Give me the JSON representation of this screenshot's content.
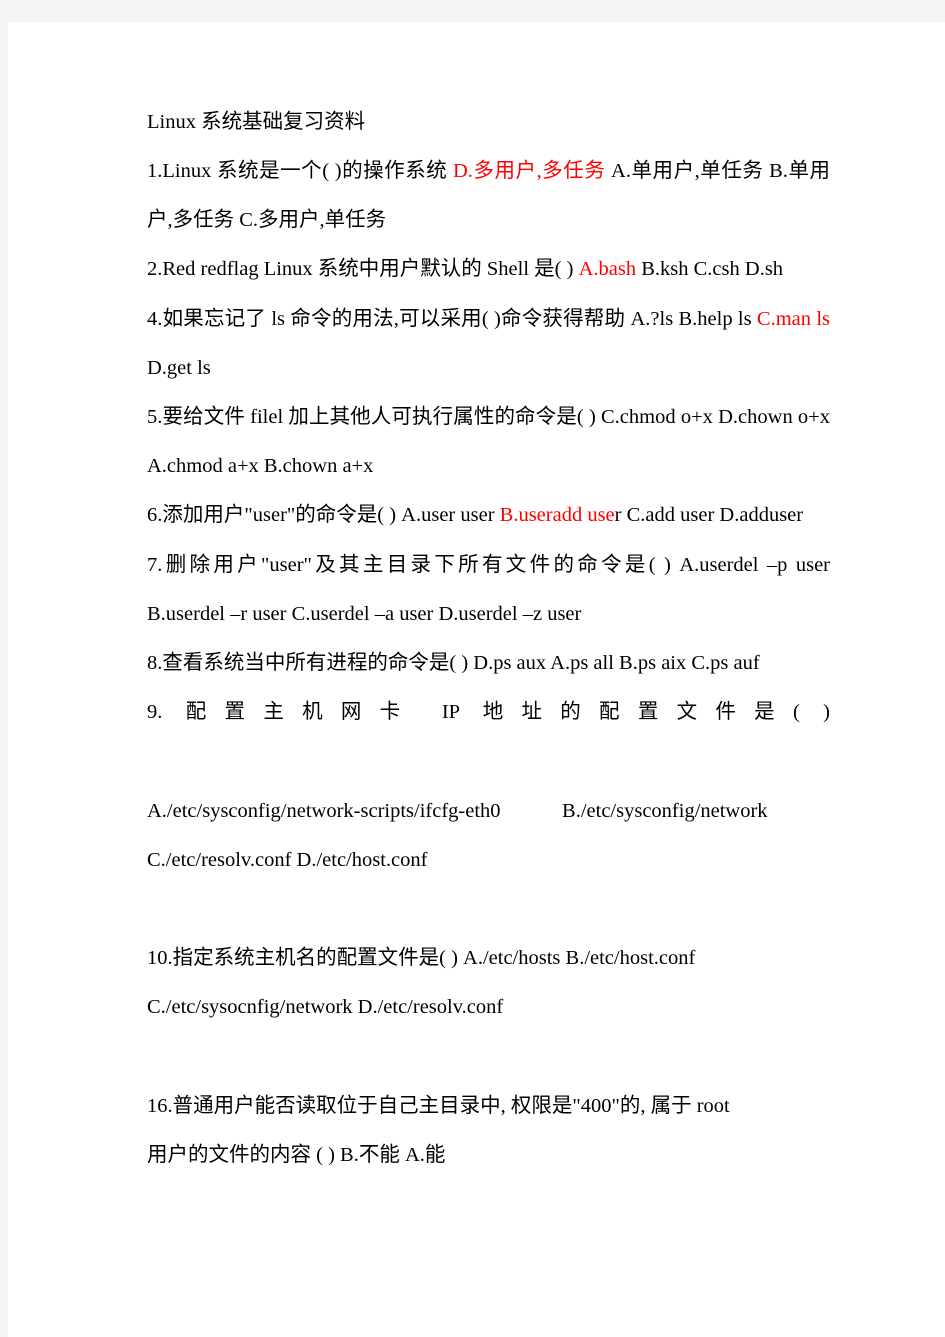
{
  "document": {
    "title": "Linux 系统基础复习资料",
    "background_color": "#f4f4f4",
    "page_color": "#ffffff",
    "text_color": "#000000",
    "highlight_color": "#ff0000"
  },
  "questions": [
    {
      "id": "q1",
      "stem": "1.Linux  系统是一个(  )的操作系统  ",
      "answer_highlight": "D.多用户,多任务",
      "options_tail": "  A.单用户,单任务  B.单用户,多任务  C.多用户,单任务"
    },
    {
      "id": "q2",
      "stem": "2.Red  redflag  Linux  系统中用户默认的  Shell  是(  )  ",
      "answer_highlight": "A.bash",
      "options_tail": "  B.ksh  C.csh  D.sh"
    },
    {
      "id": "q4",
      "stem": "4.如果忘记了  ls  命令的用法,可以采用(  )命令获得帮助  A.?ls  B.help  ls  ",
      "answer_highlight": "C.man  ls",
      "options_tail": "  D.get  ls"
    },
    {
      "id": "q5",
      "stem": "5.要给文件  filel   加上其他人可执行属性的命令是(  )  C.chmod  o+x  D.chown  o+x  A.chmod  a+x  B.chown  a+x",
      "answer_highlight": "",
      "options_tail": ""
    },
    {
      "id": "q6",
      "stem": "6.添加用户\"user\"的命令是(  )  A.user  user  ",
      "answer_highlight": "B.useradd  use",
      "options_tail": "r  C.add  user  D.adduser"
    },
    {
      "id": "q7",
      "stem": "7.删除用户\"user\"及其主目录下所有文件的命令是(  )  A.userdel  –p  user  B.userdel  –r  user  C.userdel  –a  user  D.userdel  –z  user",
      "answer_highlight": "",
      "options_tail": ""
    },
    {
      "id": "q8",
      "stem": "8.查看系统当中所有进程的命令是(  )  D.ps  aux  A.ps  all  B.ps  aix  C.ps  auf",
      "answer_highlight": "",
      "options_tail": ""
    }
  ],
  "question9": {
    "id": "q9",
    "stem_line": "9. 配置主机网卡  IP  地址的配置文件是(  )",
    "options_line1": "A./etc/sysconfig/network-scripts/ifcfg-eth0",
    "options_line1b": "B./etc/sysconfig/network",
    "options_line2": "C./etc/resolv.conf D./etc/host.conf"
  },
  "question10": {
    "id": "q10",
    "line1": "10.指定系统主机名的配置文件是(  )  A./etc/hosts   B./etc/host.conf",
    "line2": "C./etc/sysocnfig/network D./etc/resolv.conf"
  },
  "question16": {
    "id": "q16",
    "line1": "16.普通用户能否读取位于自己主目录中, 权限是\"400\"的, 属于  root",
    "line2": "用户的文件的内容 (  ) B.不能  A.能"
  }
}
